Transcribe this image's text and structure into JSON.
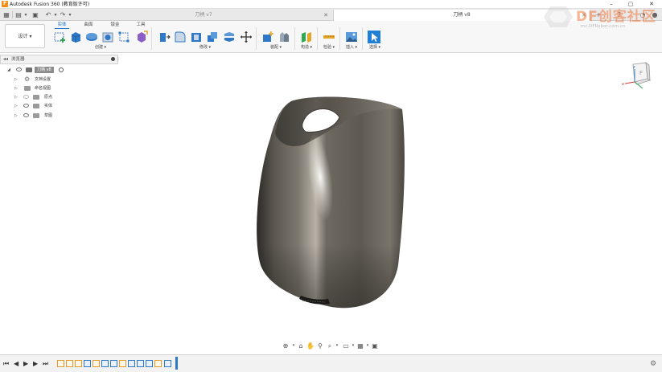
{
  "window": {
    "title": "Autodesk Fusion 360 (教育版许可)",
    "min": "–",
    "max": "▢",
    "close": "✕"
  },
  "tabs": [
    {
      "label": "刀柄 v7",
      "active": false
    },
    {
      "label": "刀柄 v8",
      "active": true
    }
  ],
  "ribbon": {
    "workspace": "设计 ▾",
    "tabs": [
      "实体",
      "曲面",
      "钣金",
      "工具"
    ],
    "groups": [
      "创建 ▾",
      "修改 ▾",
      "装配 ▾",
      "构造 ▾",
      "检验 ▾",
      "插入 ▾",
      "选择 ▾"
    ]
  },
  "browser": {
    "title": "浏览器",
    "root": "刀柄 v8",
    "items": [
      "文档设置",
      "命名视图",
      "原点",
      "实体",
      "草图"
    ]
  },
  "viewcube": {
    "face": "F",
    "x": "x",
    "z": "z"
  },
  "watermark": {
    "brand": "DF创客社区",
    "url": "mc.DFRobot.com.cn"
  },
  "colors": {
    "accent": "#1a73c7",
    "timeline_feature": "#e39a2a",
    "model": "#5e5a52"
  }
}
